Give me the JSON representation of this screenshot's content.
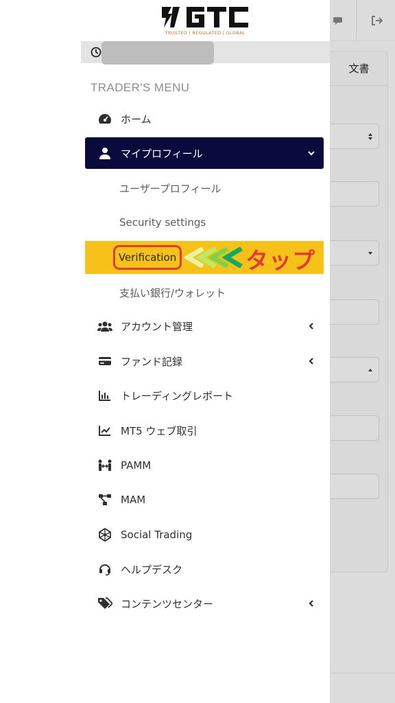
{
  "brand": {
    "logo_text": "GTC",
    "tagline": "TRUSTED | REGULATED | GLOBAL",
    "accent_color": "#b87333"
  },
  "background_page": {
    "tab_label": "文書",
    "topbar_icons": [
      "chat-icon",
      "logout-icon"
    ]
  },
  "menu": {
    "title": "TRADER'S MENU",
    "items": [
      {
        "label": "ホーム",
        "icon": "dashboard-icon"
      },
      {
        "label": "マイプロフィール",
        "icon": "user-icon",
        "active": true,
        "expanded": true
      },
      {
        "label": "アカウント管理",
        "icon": "users-icon"
      },
      {
        "label": "ファンド記録",
        "icon": "credit-card-icon"
      },
      {
        "label": "トレーディングレポート",
        "icon": "bar-chart-icon"
      },
      {
        "label": "MT5 ウェブ取引",
        "icon": "line-chart-icon"
      },
      {
        "label": "PAMM",
        "icon": "people-arrows-icon"
      },
      {
        "label": "MAM",
        "icon": "network-icon"
      },
      {
        "label": "Social Trading",
        "icon": "atom-icon"
      },
      {
        "label": "ヘルプデスク",
        "icon": "headset-icon"
      },
      {
        "label": "コンテンツセンター",
        "icon": "tags-icon"
      }
    ],
    "sub_items": [
      {
        "label": "ユーザープロフィール"
      },
      {
        "label": "Security settings"
      },
      {
        "label": "Verification",
        "highlighted": true
      },
      {
        "label": "支払い銀行/ウォレット"
      }
    ],
    "active_color": "#0a0a3d"
  },
  "annotation": {
    "tap_label": "タップ",
    "highlight_color": "#f6c21a",
    "outline_color": "#e53935"
  }
}
